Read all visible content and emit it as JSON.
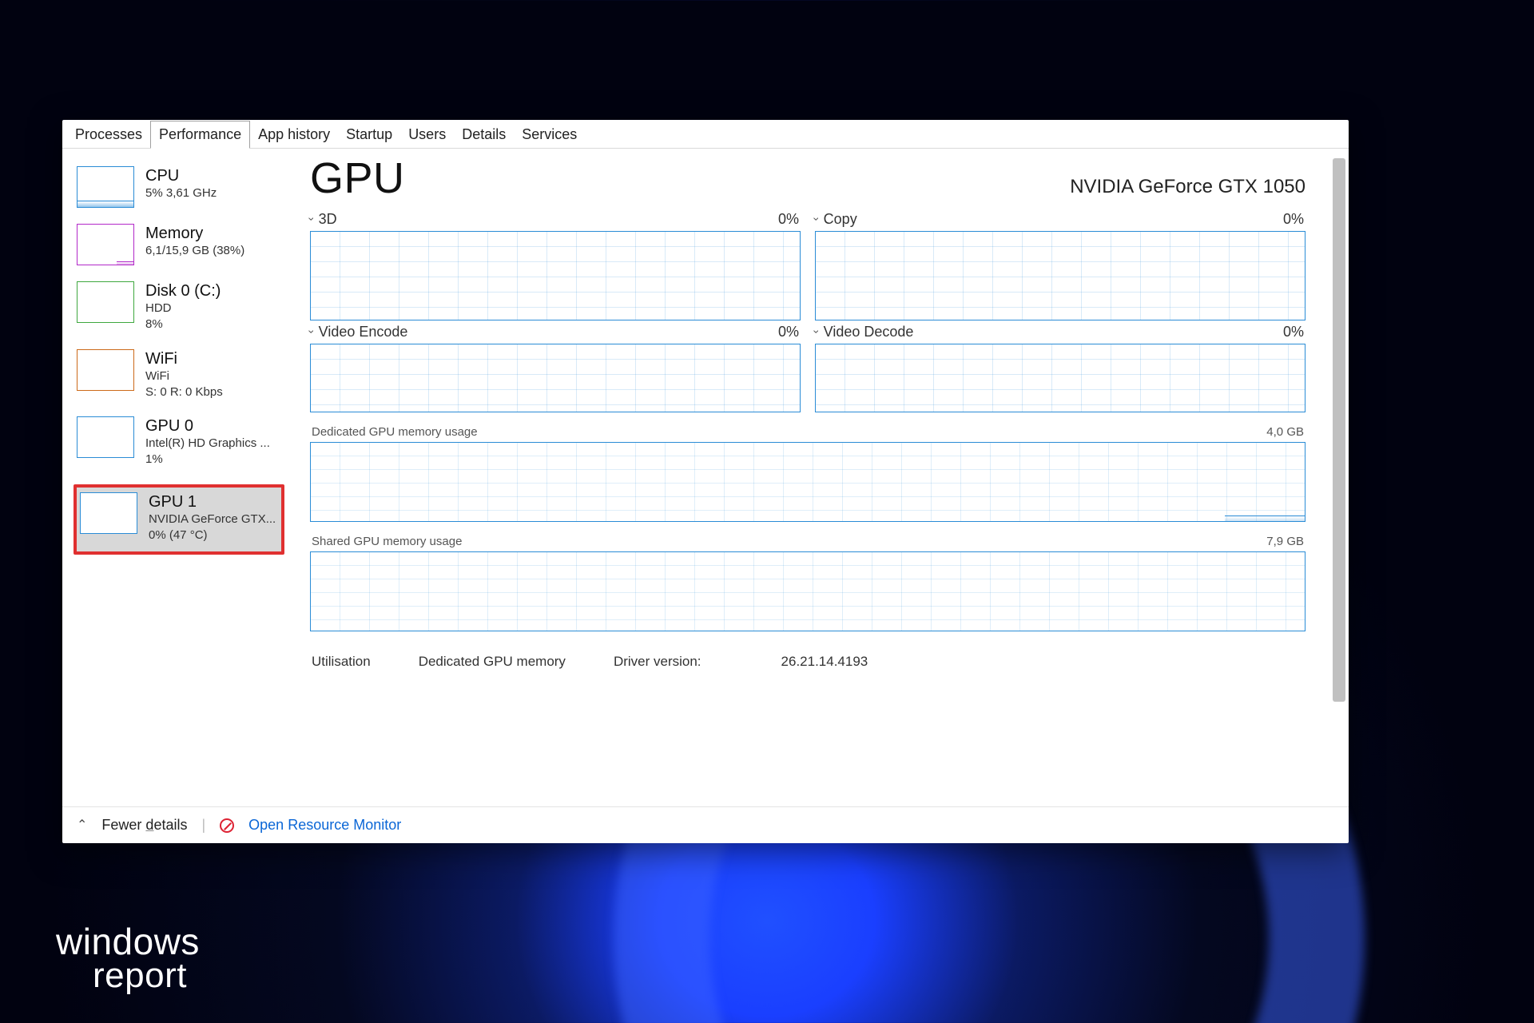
{
  "watermark": {
    "line1": "windows",
    "line2": "report"
  },
  "tabs": {
    "processes": "Processes",
    "performance": "Performance",
    "app_history": "App history",
    "startup": "Startup",
    "users": "Users",
    "details": "Details",
    "services": "Services"
  },
  "sidebar": [
    {
      "id": "cpu",
      "title": "CPU",
      "sub": "5%  3,61 GHz",
      "sub2": ""
    },
    {
      "id": "memory",
      "title": "Memory",
      "sub": "6,1/15,9 GB (38%)",
      "sub2": ""
    },
    {
      "id": "disk",
      "title": "Disk 0 (C:)",
      "sub": "HDD",
      "sub2": "8%"
    },
    {
      "id": "wifi",
      "title": "WiFi",
      "sub": "WiFi",
      "sub2": "S: 0  R: 0 Kbps"
    },
    {
      "id": "gpu0",
      "title": "GPU 0",
      "sub": "Intel(R) HD Graphics ...",
      "sub2": "1%"
    },
    {
      "id": "gpu1",
      "title": "GPU 1",
      "sub": "NVIDIA GeForce GTX...",
      "sub2": "0%  (47 °C)"
    }
  ],
  "main": {
    "title": "GPU",
    "device": "NVIDIA GeForce GTX 1050",
    "charts": [
      {
        "name": "3D",
        "value": "0%"
      },
      {
        "name": "Copy",
        "value": "0%"
      },
      {
        "name": "Video Encode",
        "value": "0%"
      },
      {
        "name": "Video Decode",
        "value": "0%"
      }
    ],
    "dedicated": {
      "label": "Dedicated GPU memory usage",
      "max": "4,0 GB"
    },
    "shared": {
      "label": "Shared GPU memory usage",
      "max": "7,9 GB"
    },
    "stats": {
      "utilisation_label": "Utilisation",
      "dedicated_label": "Dedicated GPU memory",
      "driver_label": "Driver version:",
      "driver_value": "26.21.14.4193"
    }
  },
  "footer": {
    "fewer_details": "Fewer details",
    "open_resource_monitor": "Open Resource Monitor"
  }
}
